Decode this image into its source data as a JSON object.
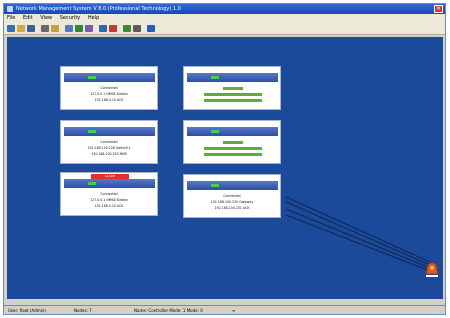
{
  "window": {
    "title": "Network Management System V 8.0 (Professional Technology) 1.0"
  },
  "menu": {
    "items": [
      "File",
      "Edit",
      "View",
      "Security",
      "Help"
    ]
  },
  "toolbar": {
    "buttons": [
      {
        "icon": "new-icon",
        "color": "#2e6fb8"
      },
      {
        "icon": "open-folder-icon",
        "color": "#d8a73c"
      },
      {
        "icon": "save-icon",
        "color": "#3a5fa0"
      },
      {
        "icon": "print-icon",
        "color": "#6a6a6a"
      },
      {
        "icon": "tools-icon",
        "color": "#c8a040"
      },
      {
        "icon": "device-icon",
        "color": "#4e7bc4"
      },
      {
        "icon": "network-icon",
        "color": "#2a8a3a"
      },
      {
        "icon": "settings-icon",
        "color": "#7a5ab0"
      },
      {
        "icon": "globe-icon",
        "color": "#2a6ab0"
      },
      {
        "icon": "monitor-icon",
        "color": "#c43b2e"
      },
      {
        "icon": "chart-icon",
        "color": "#3b8a3b"
      },
      {
        "icon": "grid-icon",
        "color": "#5a5a5a"
      },
      {
        "icon": "help-icon",
        "color": "#2a58c0"
      }
    ]
  },
  "colors": {
    "canvas": "#1c4a9a",
    "alarm": "#e53228",
    "status_ok": "#3dd24a",
    "highlight_text": "#5fae3a"
  },
  "devices": [
    {
      "id": "dev-1",
      "alarm": false,
      "lines": [
        "Connected",
        "127.0.0.1 NMS8 Station",
        "192.168.0.10 ACK"
      ],
      "highlight": false
    },
    {
      "id": "dev-2",
      "alarm": false,
      "lines": [
        "Connected",
        "192.168.100.224 Router",
        "192.168.100.254 ACK"
      ],
      "highlight": true
    },
    {
      "id": "dev-3",
      "alarm": false,
      "lines": [
        "Connected",
        "192.168.100.226 Switch01",
        "192.168.100.250 NMS"
      ],
      "highlight": false
    },
    {
      "id": "dev-4",
      "alarm": false,
      "lines": [
        "Connected",
        "192.168.100.228 Switch02",
        "192.168.100.251 NMS"
      ],
      "highlight": true
    },
    {
      "id": "dev-5",
      "alarm": true,
      "alarm_label": "ALARM",
      "lines": [
        "Connected",
        "127.0.0.1 NMS8 Station",
        "192.168.0.10 ACK"
      ],
      "highlight": false
    },
    {
      "id": "dev-6",
      "alarm": false,
      "lines": [
        "Connected",
        "192.168.100.230 Gateway",
        "192.168.100.231 ACK"
      ],
      "highlight": false
    }
  ],
  "status": {
    "user": "User: Root (Admin)",
    "nodes": "Nodes: 7",
    "name": "Name: Controller Mode: 1 Mode: 0",
    "indicator": "≡"
  }
}
